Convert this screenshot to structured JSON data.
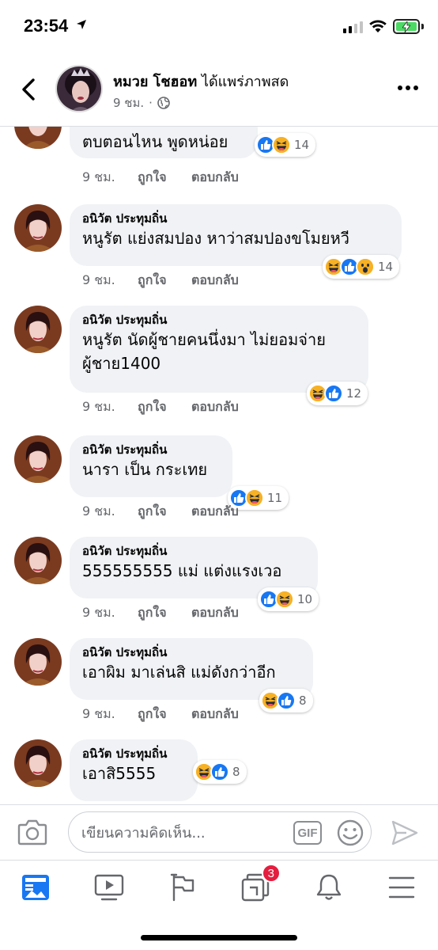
{
  "status": {
    "time": "23:54"
  },
  "header": {
    "name": "หมวย โชฮอท",
    "action": "ได้แพร่ภาพสด",
    "time": "9 ชม.",
    "dot": "·"
  },
  "first_comment": {
    "text": "ตบตอนไหน พูดหน่อย",
    "time": "9 ชม.",
    "like": "ถูกใจ",
    "reply": "ตอบกลับ",
    "reactions": [
      "like",
      "haha"
    ],
    "count": "14"
  },
  "comments": [
    {
      "name": "อนิวัต ประทุมถิ่น",
      "lines": [
        "หนูรัต แย่งสมปอง  หาว่าสมปองขโมยหวี"
      ],
      "time": "9 ชม.",
      "like": "ถูกใจ",
      "reply": "ตอบกลับ",
      "reactions": [
        "haha",
        "like",
        "wow"
      ],
      "count": "14"
    },
    {
      "name": "อนิวัต ประทุมถิ่น",
      "lines": [
        "หนูรัต นัดผู้ชายคนนึ่งมา ไม่ยอมจ่าย",
        "ผู้ชาย1400"
      ],
      "time": "9 ชม.",
      "like": "ถูกใจ",
      "reply": "ตอบกลับ",
      "reactions": [
        "haha",
        "like"
      ],
      "count": "12"
    },
    {
      "name": "อนิวัต ประทุมถิ่น",
      "lines": [
        "นารา เป็น กระเทย"
      ],
      "time": "9 ชม.",
      "like": "ถูกใจ",
      "reply": "ตอบกลับ",
      "reactions": [
        "like",
        "haha"
      ],
      "count": "11"
    },
    {
      "name": "อนิวัต ประทุมถิ่น",
      "lines": [
        "555555555 แม่ แต่งแรงเวอ"
      ],
      "time": "9 ชม.",
      "like": "ถูกใจ",
      "reply": "ตอบกลับ",
      "reactions": [
        "like",
        "haha"
      ],
      "count": "10"
    },
    {
      "name": "อนิวัต ประทุมถิ่น",
      "lines": [
        "เอาผิม มาเล่นสิ แม่ดังกว่าอีก"
      ],
      "time": "9 ชม.",
      "like": "ถูกใจ",
      "reply": "ตอบกลับ",
      "reactions": [
        "haha",
        "like"
      ],
      "count": "8"
    },
    {
      "name": "อนิวัต ประทุมถิ่น",
      "lines": [
        "เอาสิ5555"
      ],
      "time": "",
      "like": "",
      "reply": "",
      "reactions": [
        "haha",
        "like"
      ],
      "count": "8"
    }
  ],
  "composer": {
    "placeholder": "เขียนความคิดเห็น...",
    "gif_label": "GIF"
  },
  "tabs": {
    "items": [
      "news-feed",
      "watch",
      "pages",
      "groups",
      "notifications",
      "menu"
    ],
    "groups_badge": "3"
  },
  "colors": {
    "accent": "#1877f2",
    "haha": "#f7b125",
    "badge": "#e41e3f",
    "bubble": "#f0f2f5"
  }
}
